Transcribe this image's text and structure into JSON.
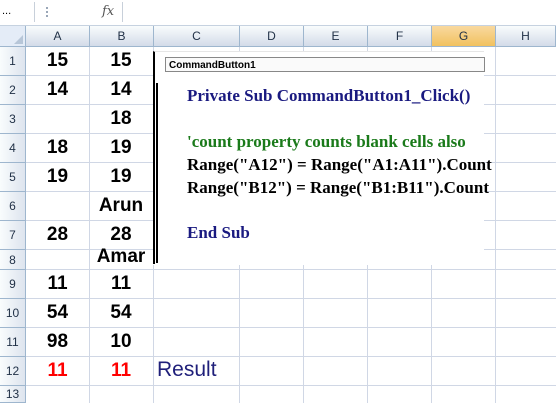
{
  "formula_bar": {
    "name_box": "...",
    "fx": "fx"
  },
  "columns": [
    "A",
    "B",
    "C",
    "D",
    "E",
    "F",
    "G",
    "H"
  ],
  "selected_column": "G",
  "rows": [
    "1",
    "2",
    "3",
    "4",
    "5",
    "6",
    "7",
    "8",
    "9",
    "10",
    "11",
    "12",
    "13"
  ],
  "cells": {
    "A": [
      "15",
      "14",
      "",
      "18",
      "19",
      "",
      "28",
      "",
      "11",
      "54",
      "98",
      "11",
      ""
    ],
    "B": [
      "15",
      "14",
      "18",
      "19",
      "19",
      "Arun",
      "28",
      "Amar",
      "11",
      "54",
      "10",
      "11",
      ""
    ]
  },
  "result_label": "Result",
  "colors": {
    "result_values": "#ff0000",
    "result_label": "#1f1f7a",
    "keyword": "#1a1a80",
    "comment": "#1a7a1a",
    "selected_header": "#f1c15f"
  },
  "code_window": {
    "button_caption": "CommandButton1",
    "line1_kw": "Private Sub",
    "line1_rest": " CommandButton1_Click()",
    "comment": "'count property counts blank cells also",
    "line2": "Range(\"A12\") = Range(\"A1:A11\").Count",
    "line3": "Range(\"B12\") = Range(\"B1:B11\").Count",
    "end": "End Sub"
  }
}
